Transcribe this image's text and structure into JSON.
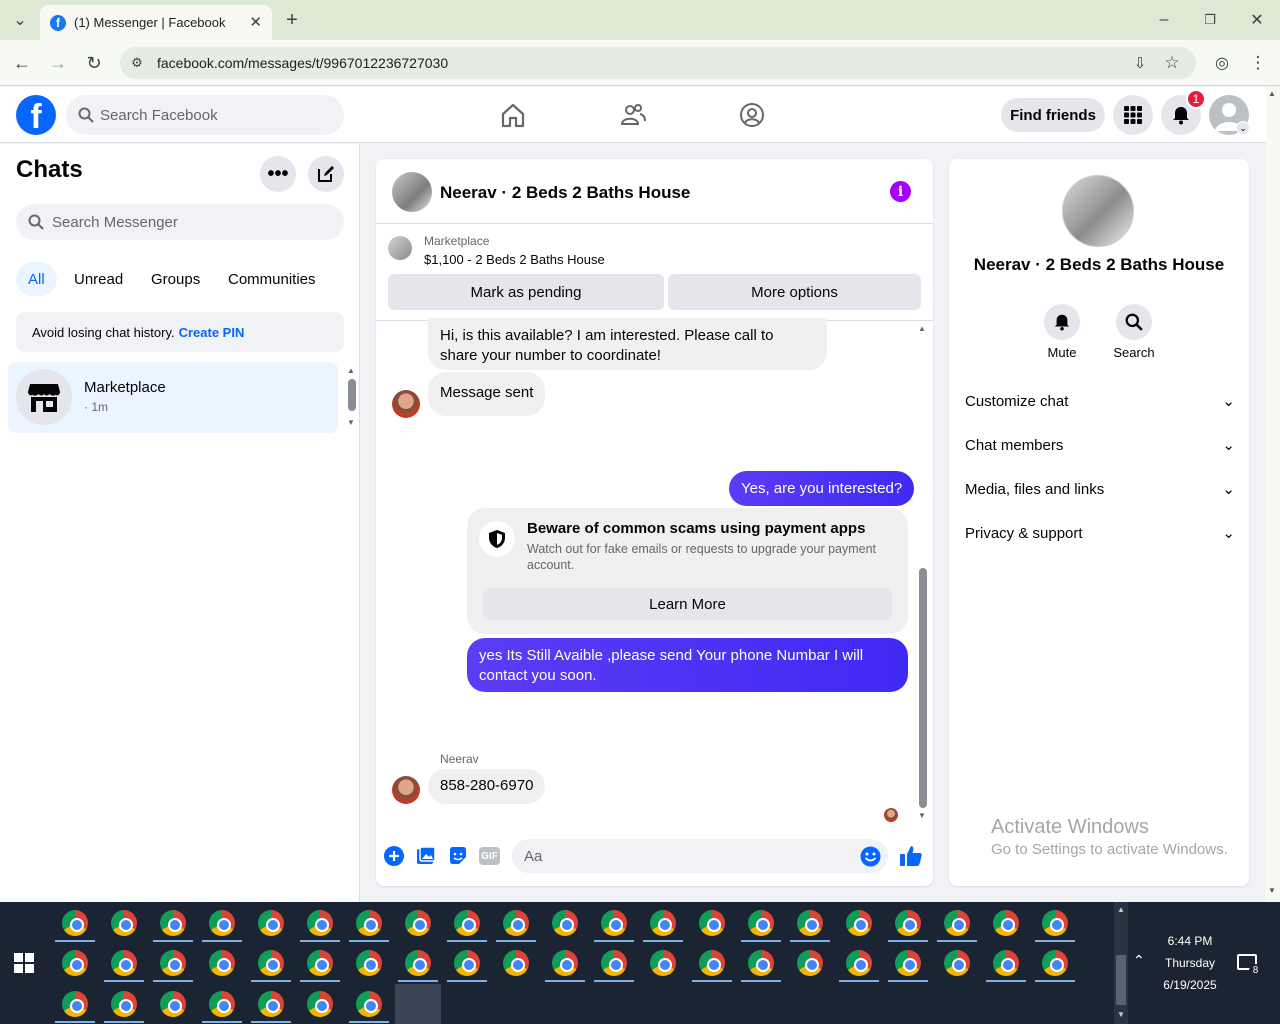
{
  "browser": {
    "tab_title": "(1) Messenger | Facebook",
    "url": "facebook.com/messages/t/9967012236727030"
  },
  "header": {
    "search_placeholder": "Search Facebook",
    "find_friends": "Find friends",
    "notification_count": "1"
  },
  "sidebar": {
    "title": "Chats",
    "search_placeholder": "Search Messenger",
    "filters": [
      "All",
      "Unread",
      "Groups",
      "Communities"
    ],
    "active_filter": "All",
    "pin_notice": "Avoid losing chat history.",
    "pin_link": "Create PIN",
    "chats": [
      {
        "name": "Marketplace",
        "time": "· 1m"
      }
    ]
  },
  "conversation": {
    "title": "Neerav · 2 Beds 2 Baths House",
    "marketplace_label": "Marketplace",
    "listing": "$1,100 - 2 Beds 2 Baths House",
    "mark_pending": "Mark as pending",
    "more_options": "More options",
    "messages": [
      {
        "direction": "in",
        "text": "Hi, is this available? I am interested. Please call to share your number to coordinate!"
      },
      {
        "direction": "in",
        "text": "Message sent"
      },
      {
        "direction": "out",
        "text": "Yes, are you interested?"
      },
      {
        "direction": "out",
        "text": "yes Its Still Avaible ,please send Your phone Numbar I will contact you soon."
      },
      {
        "direction": "in",
        "sender": "Neerav",
        "text": "858-280-6970"
      }
    ],
    "scam_notice": {
      "title": "Beware of common scams using payment apps",
      "body": "Watch out for fake emails or requests to upgrade your payment account.",
      "button": "Learn More"
    },
    "composer_placeholder": "Aa"
  },
  "details": {
    "name": "Neerav · 2 Beds 2 Baths House",
    "actions": [
      "Mute",
      "Search"
    ],
    "sections": [
      "Customize chat",
      "Chat members",
      "Media, files and links",
      "Privacy & support"
    ]
  },
  "watermark": {
    "line1": "Activate Windows",
    "line2": "Go to Settings to activate Windows."
  },
  "taskbar": {
    "time": "6:44 PM",
    "day": "Thursday",
    "date": "6/19/2025",
    "notification_count": "8"
  },
  "colors": {
    "brand": "#0866ff",
    "outgoing_bubble": "#4b33f4",
    "info_icon": "#a300ff",
    "notification_badge": "#e41e3f"
  }
}
